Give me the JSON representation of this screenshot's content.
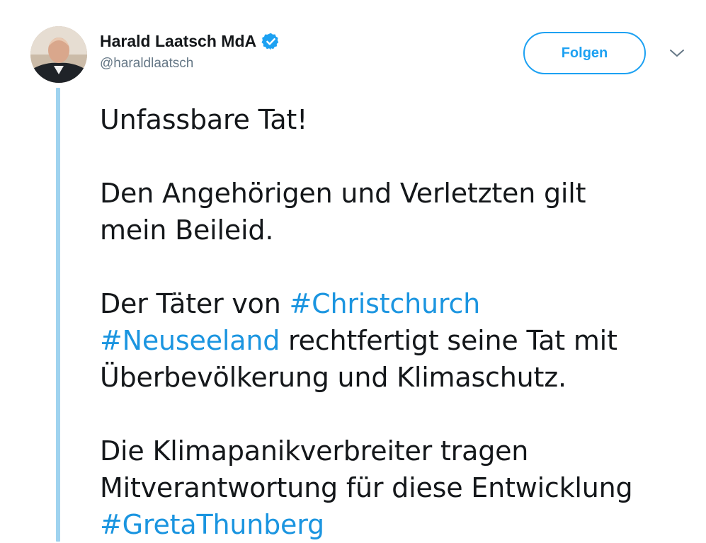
{
  "author": {
    "display_name": "Harald Laatsch MdA",
    "handle": "@haraldlaatsch",
    "verified": true
  },
  "actions": {
    "follow_label": "Folgen"
  },
  "icons": {
    "verified": "verified-badge-icon",
    "caret": "chevron-down-icon"
  },
  "tweet": {
    "line1": "Unfassbare Tat!",
    "p2_line1": "Den Angehörigen und Verletzten gilt",
    "p2_line2": "mein Beileid.",
    "p3_prefix": "Der Täter von ",
    "hashtag_christchurch": "#Christchurch",
    "hashtag_neuseeland": "#Neuseeland",
    "p3_after_neuseeland": " rechtfertigt seine Tat mit",
    "p3_line3": "Überbevölkerung und Klimaschutz.",
    "p4_line1": "Die Klimapanikverbreiter tragen",
    "p4_line2": "Mitverantwortung für diese Entwicklung",
    "hashtag_greta": "#GretaThunberg"
  },
  "colors": {
    "link": "#1b95e0",
    "accent": "#1da1f2",
    "thread_line": "#9fd3ef",
    "muted": "#657786"
  }
}
